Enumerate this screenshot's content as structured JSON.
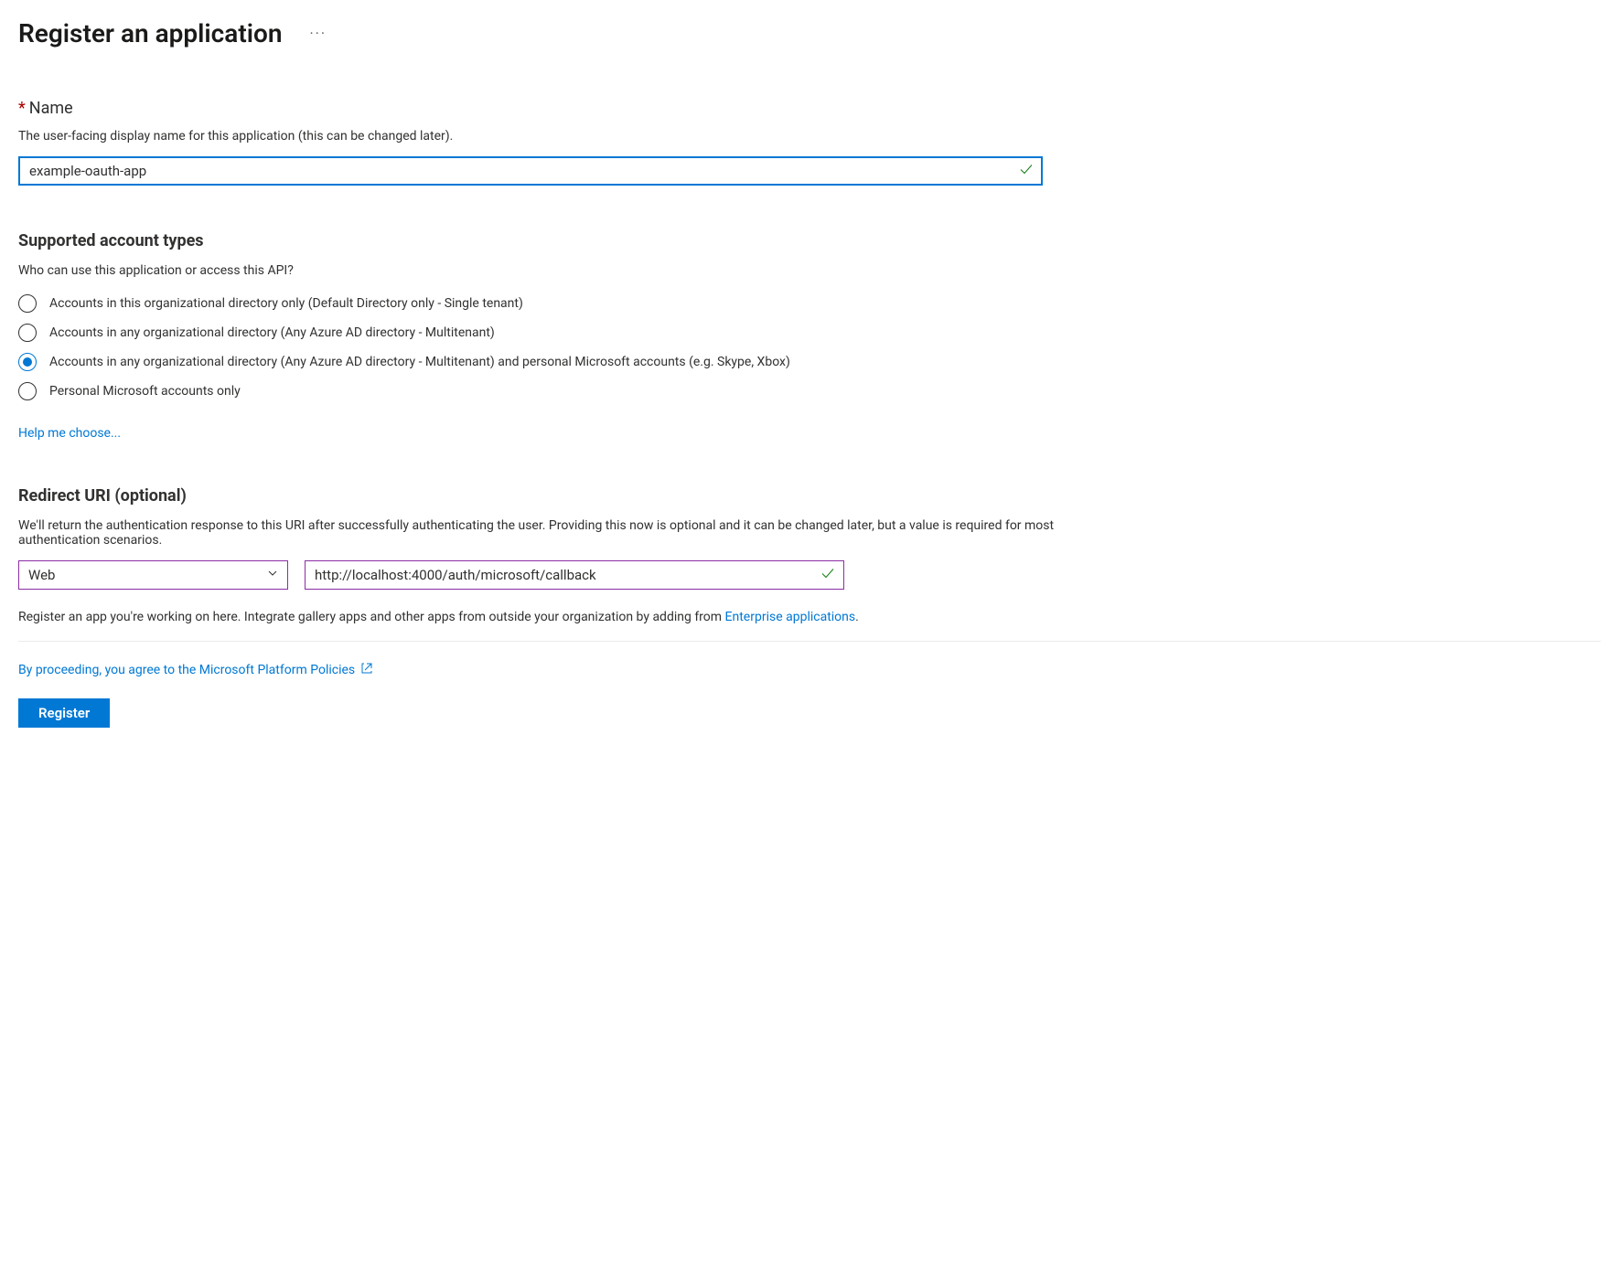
{
  "header": {
    "title": "Register an application"
  },
  "nameSection": {
    "label": "Name",
    "description": "The user-facing display name for this application (this can be changed later).",
    "value": "example-oauth-app"
  },
  "accountTypesSection": {
    "heading": "Supported account types",
    "question": "Who can use this application or access this API?",
    "options": [
      "Accounts in this organizational directory only (Default Directory only - Single tenant)",
      "Accounts in any organizational directory (Any Azure AD directory - Multitenant)",
      "Accounts in any organizational directory (Any Azure AD directory - Multitenant) and personal Microsoft accounts (e.g. Skype, Xbox)",
      "Personal Microsoft accounts only"
    ],
    "selectedIndex": 2,
    "helpLink": "Help me choose..."
  },
  "redirectSection": {
    "heading": "Redirect URI (optional)",
    "description": "We'll return the authentication response to this URI after successfully authenticating the user. Providing this now is optional and it can be changed later, but a value is required for most authentication scenarios.",
    "platformValue": "Web",
    "uriValue": "http://localhost:4000/auth/microsoft/callback"
  },
  "footer": {
    "noteText": "Register an app you're working on here. Integrate gallery apps and other apps from outside your organization by adding from ",
    "noteLink": "Enterprise applications",
    "notePeriod": ".",
    "policiesText": "By proceeding, you agree to the Microsoft Platform Policies",
    "registerLabel": "Register"
  }
}
